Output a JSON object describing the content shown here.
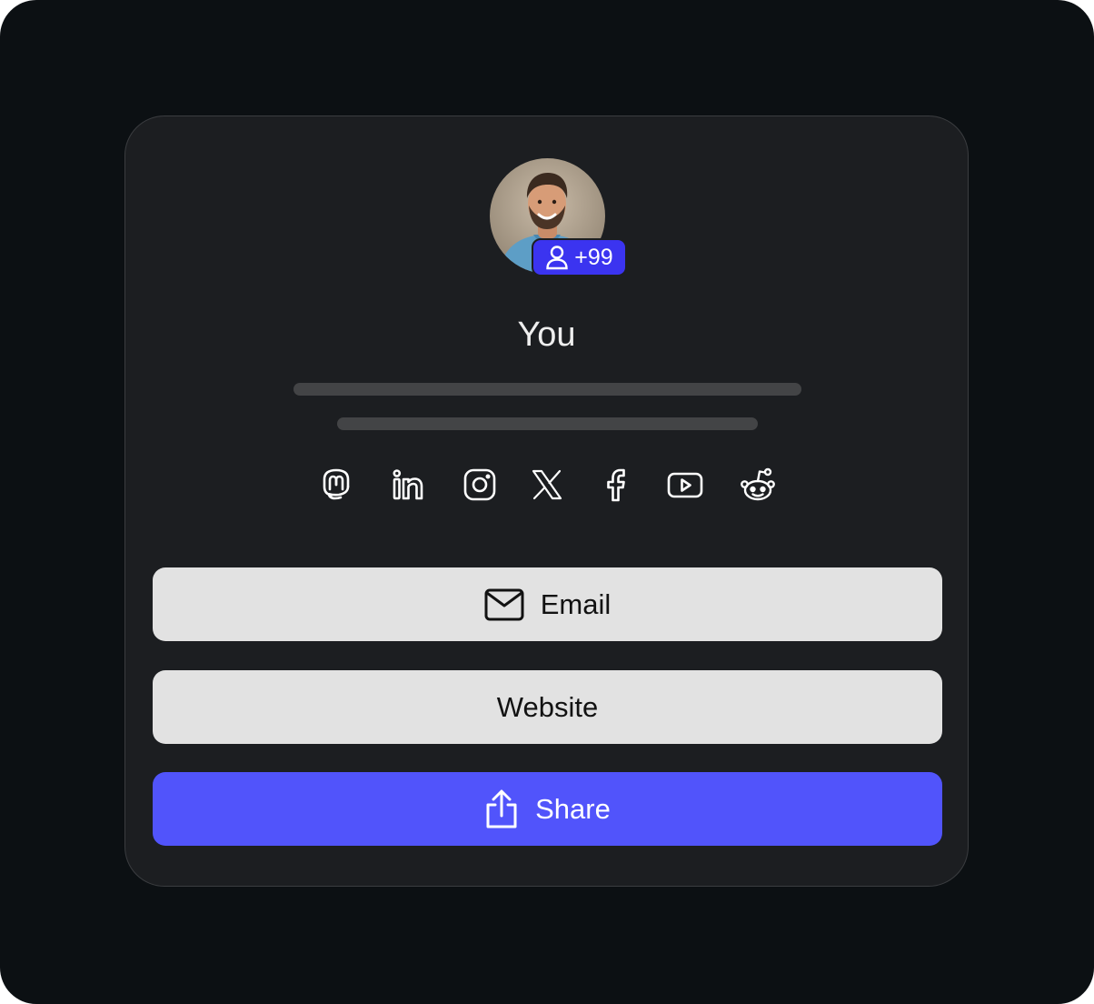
{
  "profile": {
    "name": "You",
    "followers_badge": "+99",
    "avatar_icon": "profile-photo"
  },
  "socials": [
    {
      "name": "mastodon",
      "icon": "mastodon-icon"
    },
    {
      "name": "linkedin",
      "icon": "linkedin-icon"
    },
    {
      "name": "instagram",
      "icon": "instagram-icon"
    },
    {
      "name": "x",
      "icon": "x-icon"
    },
    {
      "name": "facebook",
      "icon": "facebook-icon"
    },
    {
      "name": "youtube",
      "icon": "youtube-icon"
    },
    {
      "name": "reddit",
      "icon": "reddit-icon"
    }
  ],
  "buttons": {
    "email_label": "Email",
    "website_label": "Website",
    "share_label": "Share"
  },
  "colors": {
    "background": "#0c1013",
    "card": "#1c1e21",
    "accent": "#5154fb",
    "badge": "#3b34f0",
    "light_button": "#e2e2e2",
    "placeholder_bar": "#434446"
  }
}
